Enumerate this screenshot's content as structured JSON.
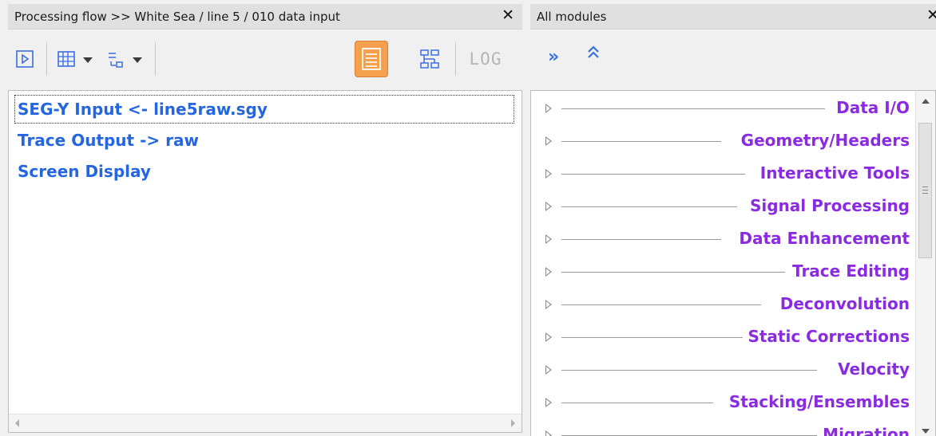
{
  "left_panel": {
    "title": "Processing flow >> White Sea / line 5 / 010 data input",
    "close_label": "✕",
    "toolbar": {
      "run_icon": "play-icon",
      "columns_icon": "columns-icon",
      "tree_icon": "tree-indent-icon",
      "list_view_icon": "list-view-icon",
      "graph_view_icon": "graph-view-icon",
      "log_label": "LOG",
      "list_view_active_color": "#f5a04c"
    },
    "flow_items": [
      {
        "label": "SEG-Y Input <- line5raw.sgy",
        "selected": true
      },
      {
        "label": "Trace Output -> raw",
        "selected": false
      },
      {
        "label": "Screen Display",
        "selected": false
      }
    ]
  },
  "right_panel": {
    "title": "All modules",
    "close_label": "✕",
    "toolbar": {
      "expand_all_label": "»",
      "collapse_all_label": "⌃"
    },
    "categories": [
      "Data I/O",
      "Geometry/Headers",
      "Interactive Tools",
      "Signal Processing",
      "Data Enhancement",
      "Trace Editing",
      "Deconvolution",
      "Static Corrections",
      "Velocity",
      "Stacking/Ensembles",
      "Migration"
    ]
  },
  "colors": {
    "flow_item": "#2466e0",
    "category": "#8a2be2",
    "accent": "#f5a04c",
    "icon": "#3b6fe0"
  }
}
